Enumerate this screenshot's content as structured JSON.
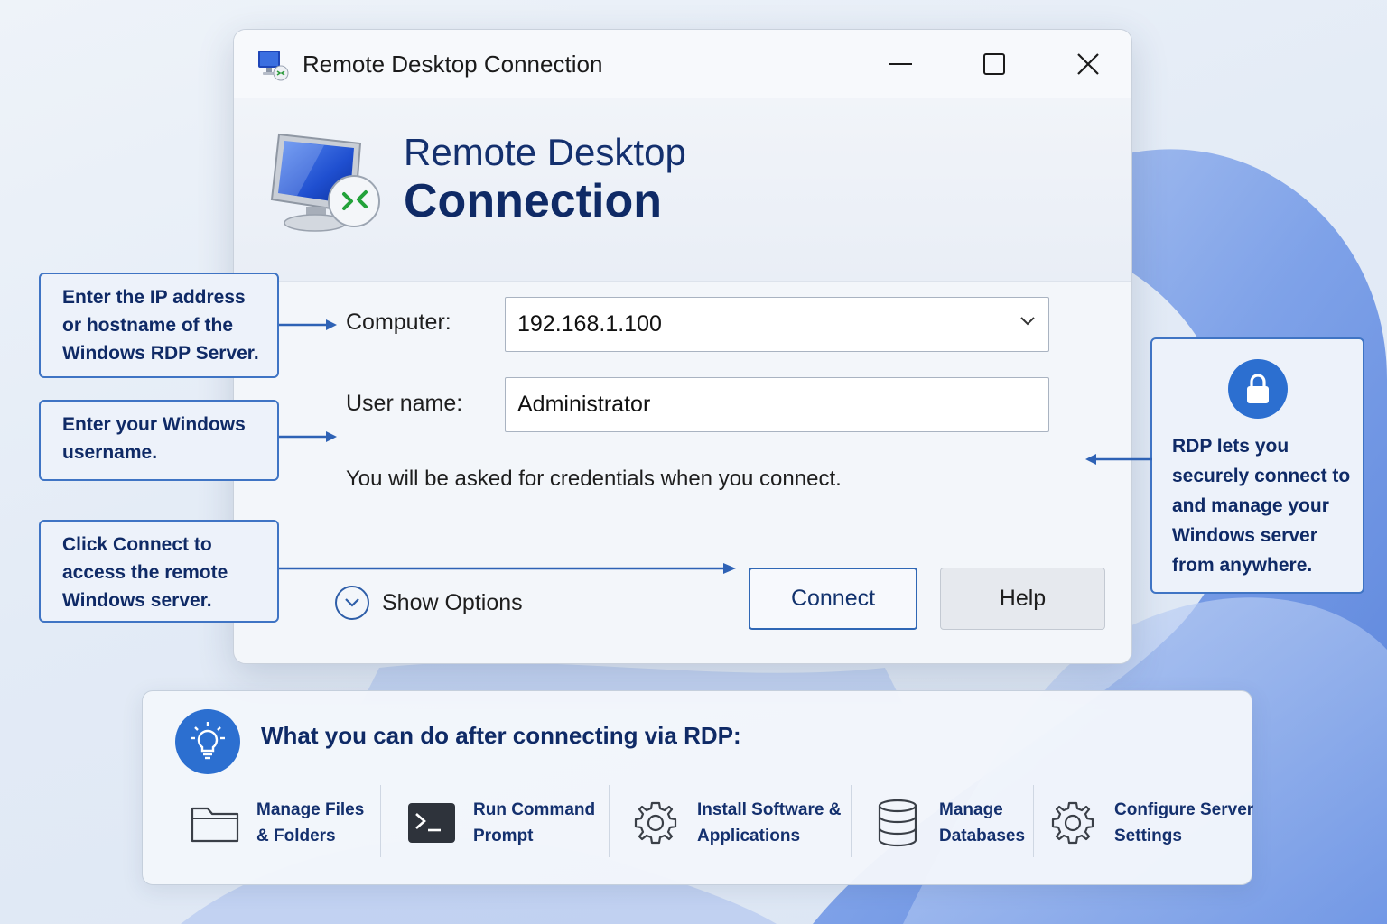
{
  "window": {
    "title": "Remote Desktop Connection",
    "banner_line1": "Remote Desktop",
    "banner_line2": "Connection"
  },
  "form": {
    "computer_label": "Computer:",
    "computer_value": "192.168.1.100",
    "username_label": "User name:",
    "username_value": "Administrator",
    "hint": "You will be asked for credentials when you connect.",
    "show_options": "Show Options",
    "connect": "Connect",
    "help": "Help"
  },
  "callouts": {
    "computer": [
      "Enter the IP address",
      "or hostname of the",
      "Windows RDP Server."
    ],
    "username": [
      "Enter your Windows",
      "username."
    ],
    "connect": [
      "Click Connect to",
      "access the remote",
      "Windows server."
    ],
    "security": [
      "RDP lets you",
      "securely connect to",
      "and manage your",
      "Windows server",
      "from anywhere."
    ]
  },
  "panel": {
    "title": "What you can do after connecting via RDP:",
    "features": [
      {
        "icon": "folder-icon",
        "lines": [
          "Manage Files",
          "& Folders"
        ]
      },
      {
        "icon": "terminal-icon",
        "lines": [
          "Run Command",
          "Prompt"
        ]
      },
      {
        "icon": "gear-icon",
        "lines": [
          "Install Software &",
          "Applications"
        ]
      },
      {
        "icon": "database-icon",
        "lines": [
          "Manage",
          "Databases"
        ]
      },
      {
        "icon": "gear-icon",
        "lines": [
          "Configure Server",
          "Settings"
        ]
      }
    ]
  },
  "colors": {
    "accent": "#2c6fd0",
    "navy_text": "#0f2a66",
    "callout_border": "#3f74c4"
  }
}
